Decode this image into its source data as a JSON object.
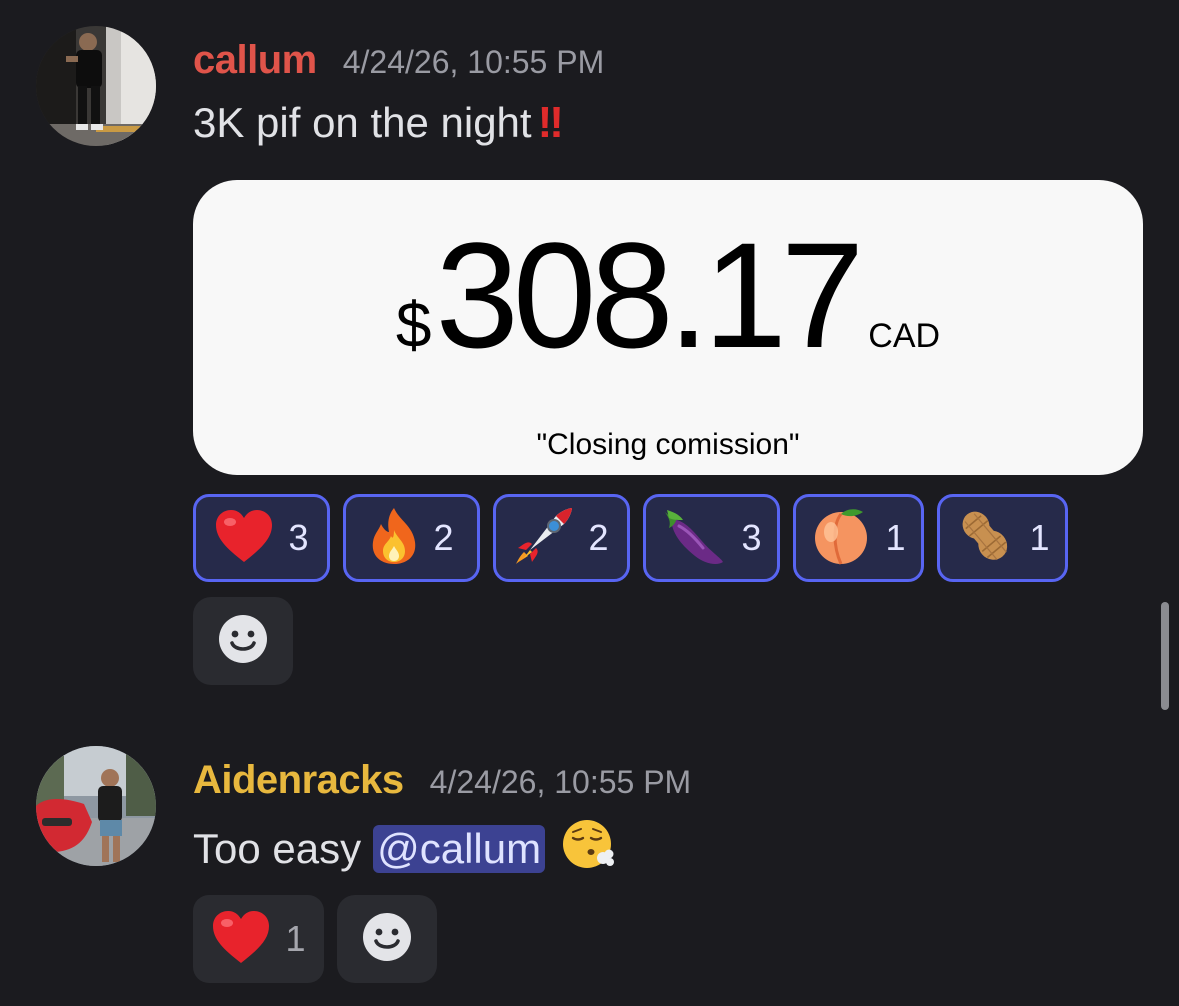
{
  "messages": [
    {
      "username": "callum",
      "username_color": "#e0544a",
      "timestamp": "4/24/26, 10:55 PM",
      "text": "3K pif on the night",
      "bang": "!!",
      "card": {
        "currency_symbol": "$",
        "amount": "308.17",
        "currency_code": "CAD",
        "note": "\"Closing comission\""
      },
      "reactions": [
        {
          "emoji": "heart-icon",
          "count": "3"
        },
        {
          "emoji": "fire-icon",
          "count": "2"
        },
        {
          "emoji": "rocket-icon",
          "count": "2"
        },
        {
          "emoji": "eggplant-icon",
          "count": "3"
        },
        {
          "emoji": "peach-icon",
          "count": "1"
        },
        {
          "emoji": "peanuts-icon",
          "count": "1"
        }
      ]
    },
    {
      "username": "Aidenracks",
      "username_color": "#e8b83e",
      "timestamp": "4/24/26, 10:55 PM",
      "text": "Too easy",
      "mention": "@callum",
      "emoji": "face-exhaling-icon",
      "reactions": [
        {
          "emoji": "heart-icon",
          "count": "1"
        }
      ]
    }
  ],
  "colors": {
    "background": "#1b1b1f",
    "accent": "#5865f2",
    "mention_bg": "#3c4292"
  },
  "add_reaction_icon": "smiley-icon"
}
